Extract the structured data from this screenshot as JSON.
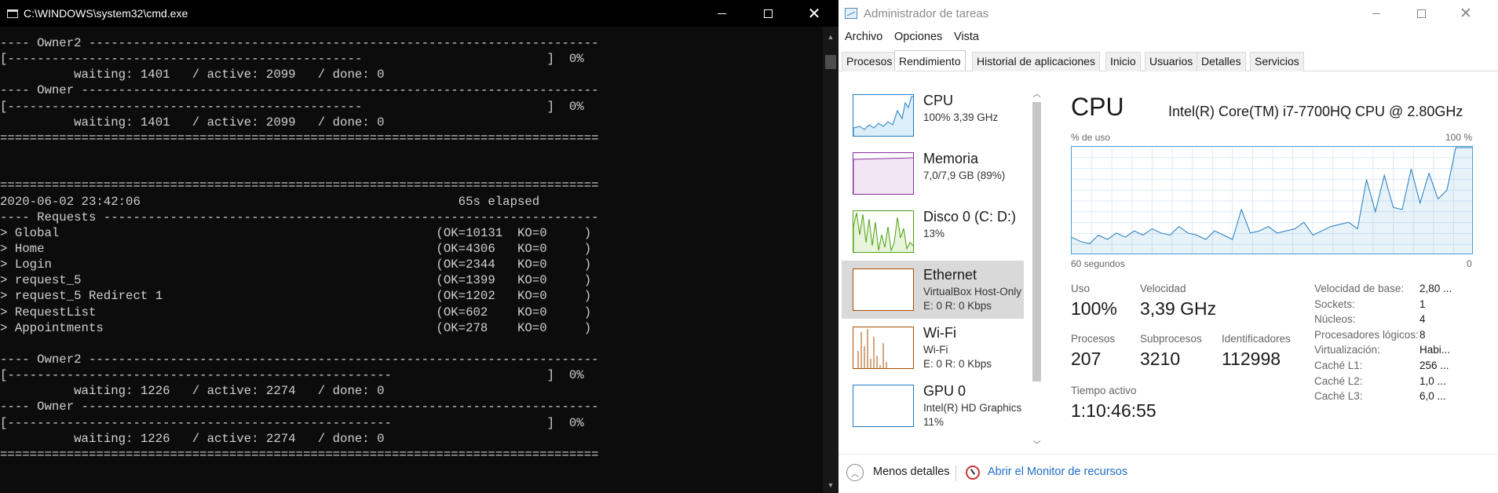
{
  "cmd": {
    "title": "C:\\WINDOWS\\system32\\cmd.exe",
    "lines": [
      "---- Owner2 ---------------------------------------------------------------------",
      "[------------------------------------------------                         ]  0%",
      "          waiting: 1401   / active: 2099   / done: 0",
      "---- Owner ----------------------------------------------------------------------",
      "[------------------------------------------------                         ]  0%",
      "          waiting: 1401   / active: 2099   / done: 0",
      "=================================================================================",
      "",
      "",
      "=================================================================================",
      "2020-06-02 23:42:06                                           65s elapsed",
      "---- Requests -------------------------------------------------------------------",
      "> Global                                                   (OK=10131  KO=0     )",
      "> Home                                                     (OK=4306   KO=0     )",
      "> Login                                                    (OK=2344   KO=0     )",
      "> request_5                                                (OK=1399   KO=0     )",
      "> request_5 Redirect 1                                     (OK=1202   KO=0     )",
      "> RequestList                                              (OK=602    KO=0     )",
      "> Appointments                                             (OK=278    KO=0     )",
      "",
      "---- Owner2 ---------------------------------------------------------------------",
      "[----------------------------------------------------                     ]  0%",
      "          waiting: 1226   / active: 2274   / done: 0",
      "---- Owner ----------------------------------------------------------------------",
      "[----------------------------------------------------                     ]  0%",
      "          waiting: 1226   / active: 2274   / done: 0",
      "================================================================================="
    ]
  },
  "taskmgr": {
    "title": "Administrador de tareas",
    "menu": [
      "Archivo",
      "Opciones",
      "Vista"
    ],
    "tabs": [
      "Procesos",
      "Rendimiento",
      "Historial de aplicaciones",
      "Inicio",
      "Usuarios",
      "Detalles",
      "Servicios"
    ],
    "active_tab": "Rendimiento",
    "resources": [
      {
        "name": "CPU",
        "sub": "100%  3,39 GHz",
        "sub2": "",
        "color": "#1f7bc1"
      },
      {
        "name": "Memoria",
        "sub": "7,0/7,9 GB (89%)",
        "sub2": "",
        "color": "#8b2fa0"
      },
      {
        "name": "Disco 0 (C: D:)",
        "sub": "13%",
        "sub2": "",
        "color": "#4da00e"
      },
      {
        "name": "Ethernet",
        "sub": "VirtualBox Host-Only",
        "sub2": "E: 0 R: 0 Kbps",
        "color": "#a74f01"
      },
      {
        "name": "Wi-Fi",
        "sub": "Wi-Fi",
        "sub2": "E: 0 R: 0 Kbps",
        "color": "#a74f01"
      },
      {
        "name": "GPU 0",
        "sub": "Intel(R) HD Graphics",
        "sub2": "11%",
        "color": "#1f7bc1"
      }
    ],
    "selected_resource": "Ethernet",
    "detail": {
      "heading": "CPU",
      "model": "Intel(R) Core(TM) i7-7700HQ CPU @ 2.80GHz",
      "graph_label_left": "% de uso",
      "graph_label_right": "100 %",
      "time_label": "60 segundos",
      "time_end": "0",
      "stats": {
        "uso_label": "Uso",
        "uso": "100%",
        "velocidad_label": "Velocidad",
        "velocidad": "3,39 GHz",
        "procesos_label": "Procesos",
        "procesos": "207",
        "subprocesos_label": "Subprocesos",
        "subprocesos": "3210",
        "identificadores_label": "Identificadores",
        "identificadores": "112998",
        "tiempo_label": "Tiempo activo",
        "tiempo": "1:10:46:55"
      },
      "specs": [
        {
          "label": "Velocidad de base:",
          "value": "2,80 ..."
        },
        {
          "label": "Sockets:",
          "value": "1"
        },
        {
          "label": "Núcleos:",
          "value": "4"
        },
        {
          "label": "Procesadores lógicos:",
          "value": "8"
        },
        {
          "label": "Virtualización:",
          "value": "Habi..."
        },
        {
          "label": "Caché L1:",
          "value": "256 ..."
        },
        {
          "label": "Caché L2:",
          "value": "1,0 ..."
        },
        {
          "label": "Caché L3:",
          "value": "6,0 ..."
        }
      ]
    },
    "footer": {
      "less_details": "Menos detalles",
      "monitor_link": "Abrir el Monitor de recursos"
    },
    "chart_data": {
      "type": "area",
      "title": "",
      "xlabel": "60 segundos",
      "ylabel": "% de uso",
      "ylim": [
        0,
        100
      ],
      "series": [
        {
          "values": [
            16,
            12,
            10,
            18,
            14,
            20,
            16,
            22,
            18,
            24,
            20,
            18,
            26,
            20,
            18,
            14,
            22,
            18,
            14,
            42,
            20,
            22,
            26,
            20,
            22,
            24,
            30,
            18,
            22,
            26,
            28,
            30,
            24,
            70,
            40,
            74,
            44,
            42,
            80,
            48,
            76,
            52,
            60,
            100,
            100,
            100
          ]
        }
      ]
    }
  }
}
